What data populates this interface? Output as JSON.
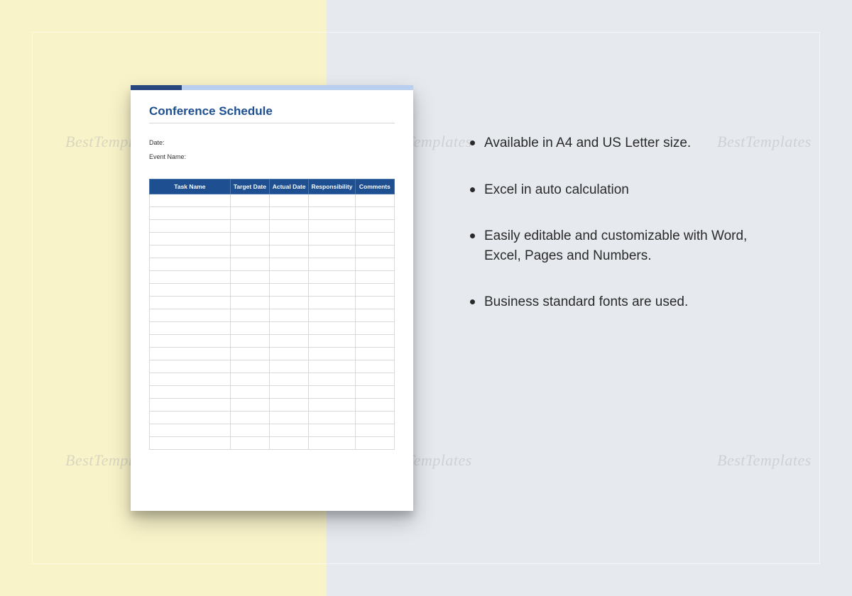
{
  "watermark_text": "BestTemplates",
  "document": {
    "title": "Conference Schedule",
    "fields": {
      "date_label": "Date:",
      "event_name_label": "Event Name:"
    },
    "table": {
      "columns": [
        "Task Name",
        "Target Date",
        "Actual Date",
        "Responsibility",
        "Comments"
      ],
      "empty_row_count": 20
    }
  },
  "features": [
    "Available in A4 and US Letter size.",
    "Excel in auto calculation",
    "Easily editable and customizable with Word, Excel, Pages and Numbers.",
    "Business standard fonts are used."
  ],
  "colors": {
    "left_bg": "#f9f3c9",
    "right_bg": "#e6eaef",
    "accent_dark": "#27477f",
    "accent_light": "#b9cff0",
    "title_blue": "#1d4f91"
  }
}
